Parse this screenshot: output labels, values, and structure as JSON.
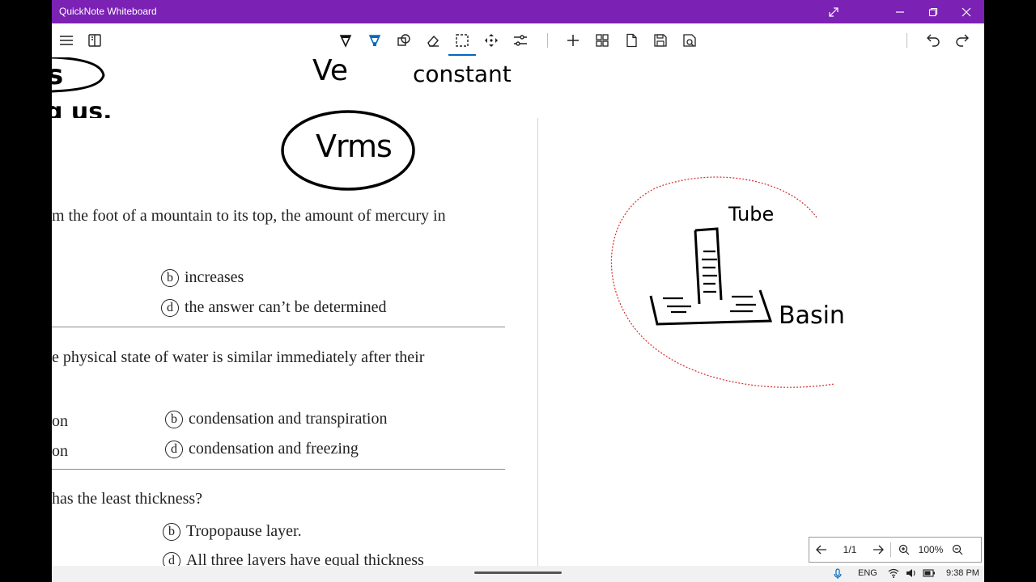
{
  "window": {
    "title": "QuickNote Whiteboard",
    "titlebar_color": "#7b21b4"
  },
  "toolbar": {
    "left_icons": [
      "menu-icon",
      "notebook-icon"
    ],
    "tools": [
      "pen-icon",
      "highlighter-icon",
      "shapes-icon",
      "eraser-icon",
      "lasso-select-icon",
      "pan-icon",
      "settings-sliders-icon"
    ],
    "actions": [
      "add-icon",
      "grid-icon",
      "page-icon",
      "save-icon",
      "export-icon"
    ],
    "history": [
      "undo-icon",
      "redo-icon"
    ],
    "active_tool": "lasso-select-icon",
    "accent": "#0067c0"
  },
  "document": {
    "q1_stem": "m the foot of a mountain to its top, the amount of mercury in",
    "q1_options": [
      {
        "letter": "b",
        "text": "increases"
      },
      {
        "letter": "d",
        "text": "the answer can’t be determined"
      }
    ],
    "q2_stem": "e physical state of water is similar immediately after their",
    "q2_options": [
      {
        "frag": "on",
        "letter": "b",
        "text": "condensation and transpiration"
      },
      {
        "frag": "on",
        "letter": "d",
        "text": "condensation and freezing"
      }
    ],
    "q3_stem": "has the least thickness?",
    "q3_options": [
      {
        "letter": "b",
        "text": "Tropopause layer."
      },
      {
        "letter": "d",
        "text": "All three layers have equal thickness"
      }
    ]
  },
  "handwriting": {
    "top_left_fragment": "s",
    "top_left_fragment2": "g us.",
    "ve_label": "Ve",
    "constant_label": "constant",
    "vrms_label": "Vrms",
    "tube_label": "Tube",
    "basin_label": "Basin",
    "lasso_color": "#d62b2b"
  },
  "pager": {
    "page": "1/1",
    "zoom": "100%"
  },
  "statusbar": {
    "lang": "ENG",
    "time": "9:38 PM"
  }
}
